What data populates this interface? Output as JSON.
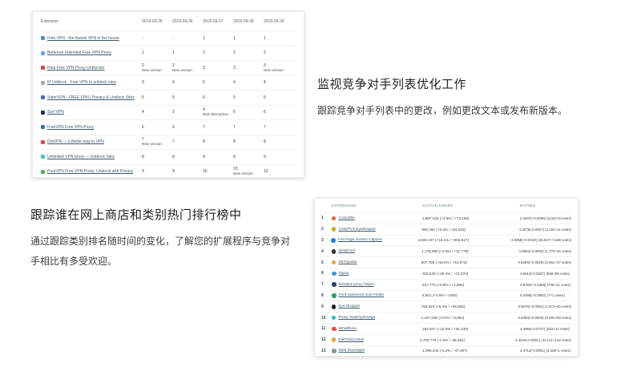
{
  "sections": {
    "monitor": {
      "heading": "监视竞争对手列表优化工作",
      "body": "跟踪竞争对手列表中的更改，例如更改文本或发布新版本。"
    },
    "popularity": {
      "heading": "跟踪谁在网上商店和类别热门排行榜中",
      "body": "通过跟踪类别排名随时间的变化，了解您的扩展程序与竞争对手相比有多受欢迎。"
    }
  },
  "rank_table": {
    "columns": [
      "Extension",
      "2019-09-25",
      "2019-09-26",
      "2019-09-27",
      "2019-09-28",
      "2019-09-29"
    ],
    "rows": [
      {
        "name": "Free VPN - the fastest VPN in the house",
        "icon": "free-vpn-icon",
        "color": "#4a8fd3",
        "cells": [
          {
            "v": "-"
          },
          {
            "v": "-"
          },
          {
            "v": "1"
          },
          {
            "v": "1"
          },
          {
            "v": "1"
          }
        ]
      },
      {
        "name": "Betternet Unlimited Free VPN Proxy",
        "icon": "betternet-icon",
        "color": "#55aee8",
        "cells": [
          {
            "v": "1"
          },
          {
            "v": "1"
          },
          {
            "v": "2"
          },
          {
            "v": "2"
          },
          {
            "v": "2"
          }
        ]
      },
      {
        "name": "Hola Free VPN Proxy Unblocker",
        "icon": "hola-icon",
        "color": "#e0452c",
        "cells": [
          {
            "v": "2",
            "n": "New version"
          },
          {
            "v": "2",
            "n": "New version"
          },
          {
            "v": "3"
          },
          {
            "v": "3"
          },
          {
            "v": "3",
            "n": "New version"
          }
        ]
      },
      {
        "name": "IP Unblock - Free VPN to unblock sites",
        "icon": "ip-unblock-icon",
        "color": "#a8a8a8",
        "cells": [
          {
            "v": "3"
          },
          {
            "v": "4"
          },
          {
            "v": "5"
          },
          {
            "v": "4"
          },
          {
            "v": "4"
          }
        ]
      },
      {
        "name": "SaferVPN - FREE VPN | Privacy & Unblock Sites",
        "icon": "safervpn-icon",
        "color": "#3f6fd8",
        "cells": [
          {
            "v": "5"
          },
          {
            "v": "5"
          },
          {
            "v": "6"
          },
          {
            "v": "5"
          },
          {
            "v": "5"
          }
        ]
      },
      {
        "name": "Surf VPN",
        "icon": "surf-vpn-icon",
        "color": "#16325c",
        "cells": [
          {
            "v": "4"
          },
          {
            "v": "3"
          },
          {
            "v": "4",
            "n": "New description"
          },
          {
            "v": "6"
          },
          {
            "v": "6"
          }
        ]
      },
      {
        "name": "FreeVPN Free VPN Proxy",
        "icon": "freevpn-icon",
        "color": "#2f6fd0",
        "cells": [
          {
            "v": "6"
          },
          {
            "v": "6"
          },
          {
            "v": "7"
          },
          {
            "v": "7"
          },
          {
            "v": "7"
          }
        ]
      },
      {
        "name": "DotVPN — a Better way to VPN",
        "icon": "dotvpn-icon",
        "color": "#d94a32",
        "cells": [
          {
            "v": "7",
            "n": "New version"
          },
          {
            "v": "7"
          },
          {
            "v": "8"
          },
          {
            "v": "8"
          },
          {
            "v": "8"
          }
        ]
      },
      {
        "name": "Unlimited VPN proxy — Unblock Sites",
        "icon": "unlimited-vpn-icon",
        "color": "#45c3d4",
        "cells": [
          {
            "v": "8"
          },
          {
            "v": "8"
          },
          {
            "v": "9"
          },
          {
            "v": "9"
          },
          {
            "v": "9"
          }
        ]
      },
      {
        "name": "PureVPN Free VPN Proxy: Unblock with Privacy",
        "icon": "purevpn-icon",
        "color": "#48b84c",
        "cells": [
          {
            "v": "9"
          },
          {
            "v": "9"
          },
          {
            "v": "10"
          },
          {
            "v": "10",
            "n": "New version"
          },
          {
            "v": "10"
          }
        ]
      }
    ]
  },
  "leaderboard": {
    "columns": [
      "EXTENSION",
      "ACTIVE USERS",
      "RATING"
    ],
    "rows": [
      {
        "rank": "1",
        "name": "ColorZilla",
        "icon": "colorzilla-icon",
        "color": "#e8632a",
        "users": "1,987,153 (+3.8% / +73,268)",
        "rating": "4.4297(+0.0006) (2,623+8 votes)"
      },
      {
        "rank": "2",
        "name": "ColorPick Eyedropper",
        "icon": "colorpick-eyedropper-icon",
        "color": "#d4a62a",
        "users": "892,292 (+6.4% / +54,042)",
        "rating": "4.2576(-0.0007) (1,192+11 votes)"
      },
      {
        "rank": "3",
        "name": "Full Page Screen Capture",
        "icon": "full-page-screen-capture-icon",
        "color": "#2f7fd4",
        "users": "3,828,247 (+15.1% / +502,617)",
        "rating": "4.8358(+0.0318) (36,627+7,638 votes)"
      },
      {
        "rank": "4",
        "name": "WhatFont",
        "icon": "whatfont-icon",
        "color": "#333333",
        "users": "1,178,985 (+2.8% / +31,779)",
        "rating": "4.0952(-0.0094) (1,776+16 votes)"
      },
      {
        "rank": "5",
        "name": "SEOquake",
        "icon": "seoquake-icon",
        "color": "#f0a32f",
        "users": "587,785 (+18.5% / +91,673)",
        "rating": "4.5559(+0.0028) (2,461+47 votes)"
      },
      {
        "rank": "6",
        "name": "Stylus",
        "icon": "stylus-icon",
        "color": "#4098d7",
        "users": "318,545 (+29.4% / +72,370)",
        "rating": "4.6813(-0.0237) (659+59 votes)"
      },
      {
        "rank": "7",
        "name": "friGate3 proxy helper",
        "icon": "frigate3-icon",
        "color": "#33475b",
        "users": "237,773 (+0.8% / +1,980)",
        "rating": "3.9783(+0.0358) (728+22 votes)"
      },
      {
        "rank": "8",
        "name": "Font Awesome Icon Finder",
        "icon": "font-awesome-icon-finder-icon",
        "color": "#2e9e5b",
        "users": "5,501 (+3.9% / +208)",
        "rating": "4.4286(+0.0952) (7+1 votes)"
      },
      {
        "rank": "9",
        "name": "Eye Dropper",
        "icon": "eye-dropper-icon",
        "color": "#222222",
        "users": "782,643 (+6.4% / +46,925)",
        "rating": "3.9578(+0.0091) (1,871+40 votes)"
      },
      {
        "rank": "10",
        "name": "Proxy SwitchyOmega",
        "icon": "proxy-switchyomega-icon",
        "color": "#35b5ac",
        "users": "1,107,635 (-0.9% / -9,962)",
        "rating": "4.6383(+0.0005) (3,481+83 votes)"
      },
      {
        "rank": "11",
        "name": "WhatRuns",
        "icon": "whatruns-icon",
        "color": "#e04b3a",
        "users": "182,947 (+15.9% / +25,130)",
        "rating": "4.3992(-0.0747) (283+14 votes)"
      },
      {
        "rank": "12",
        "name": "EditThisCookie",
        "icon": "editthiscookie-icon",
        "color": "#e8a33d",
        "users": "2,705,779 (-1.8% / -48,281)",
        "rating": "4.4244(-0.0001) (11,141+142 votes)"
      },
      {
        "rank": "13",
        "name": "Web Developer",
        "icon": "web-developer-icon",
        "color": "#8d9499",
        "users": "1,096,443 (-4.2% / -47,497)",
        "rating": "4.4712(-0.0001) (3,438+1 votes)"
      }
    ]
  }
}
